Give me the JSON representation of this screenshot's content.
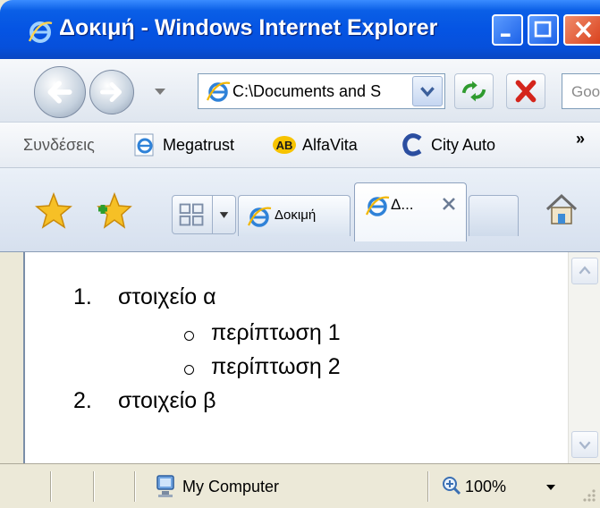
{
  "window": {
    "title": "Δοκιμή - Windows Internet Explorer"
  },
  "navigation": {
    "address": "C:\\Documents and S",
    "search_placeholder": "Goo"
  },
  "links_bar": {
    "label": "Συνδέσεις",
    "items": [
      {
        "label": "Megatrust",
        "icon": "ie-page-icon"
      },
      {
        "label": "AlfaVita",
        "icon": "ab-icon"
      },
      {
        "label": "City Auto",
        "icon": "c-logo-icon"
      }
    ],
    "overflow": "»"
  },
  "tabs": {
    "items": [
      {
        "label": "Δοκιμή",
        "active": false
      },
      {
        "label": "Δ...",
        "active": true
      }
    ]
  },
  "document": {
    "list": [
      {
        "number": "1.",
        "text": "στοιχείο α",
        "subitems": [
          "περίπτωση 1",
          "περίπτωση 2"
        ]
      },
      {
        "number": "2.",
        "text": "στοιχείο β",
        "subitems": []
      }
    ]
  },
  "status": {
    "zone": "My Computer",
    "zoom": "100%"
  },
  "colors": {
    "titlebar": "#0554e3",
    "close_button": "#d9401c",
    "stop_icon": "#d4251c",
    "refresh_icon": "#2f9b2f"
  }
}
